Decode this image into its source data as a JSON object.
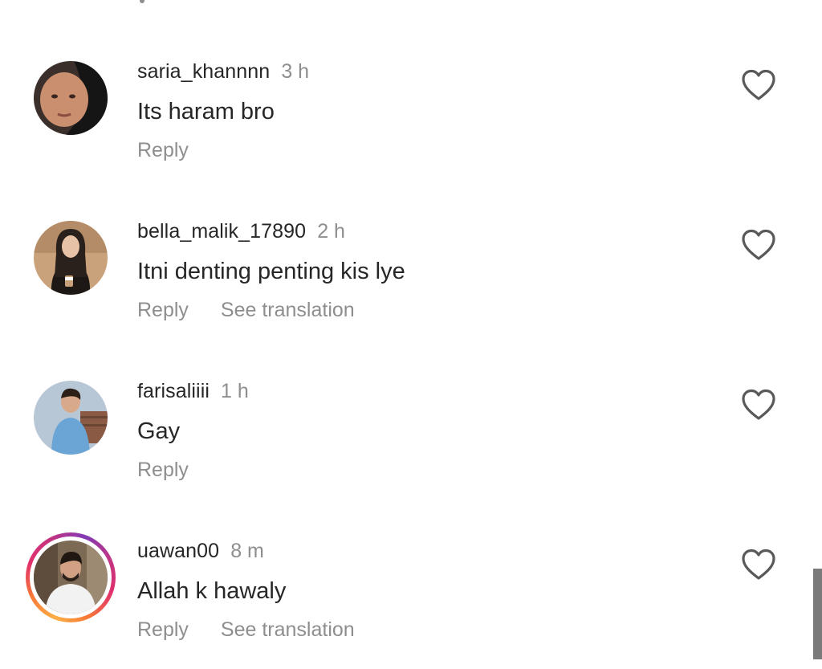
{
  "comments": [
    {
      "username": "saria_khannnn",
      "time": "3 h",
      "text": "Its haram bro",
      "reply_label": "Reply",
      "translate_label": "",
      "has_story": false,
      "avatar_colors": {
        "bg": "#3a2f2a",
        "skin": "#c98f6f",
        "hijab": "#151515"
      }
    },
    {
      "username": "bella_malik_17890",
      "time": "2 h",
      "text": "Itni denting penting kis lye",
      "reply_label": "Reply",
      "translate_label": "See translation",
      "has_story": false,
      "avatar_colors": {
        "bg": "#c9a27c",
        "skin": "#e8c2a6",
        "hijab": "#2a211c"
      }
    },
    {
      "username": "farisaliiii",
      "time": "1 h",
      "text": "Gay",
      "reply_label": "Reply",
      "translate_label": "",
      "has_story": false,
      "avatar_colors": {
        "bg": "#b7c7d6",
        "skin": "#d8a98a",
        "hijab": "#6aa5d6"
      }
    },
    {
      "username": "uawan00",
      "time": "8 m",
      "text": "Allah k hawaly",
      "reply_label": "Reply",
      "translate_label": "See translation",
      "has_story": true,
      "avatar_colors": {
        "bg": "#7d6a55",
        "skin": "#d2a184",
        "hijab": "#f2f2f2"
      }
    }
  ],
  "colors": {
    "text": "#262626",
    "secondary": "#8e8e8e",
    "heart_stroke": "#595959",
    "scrollbar": "#7a7a7a"
  }
}
